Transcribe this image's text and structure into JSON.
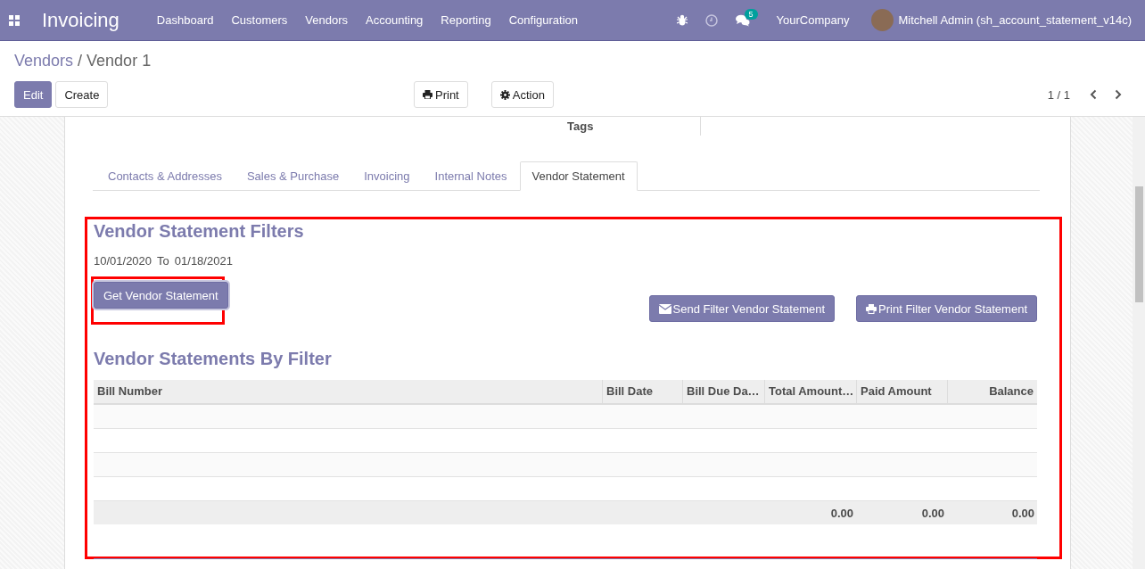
{
  "navbar": {
    "app_name": "Invoicing",
    "menu": [
      "Dashboard",
      "Customers",
      "Vendors",
      "Accounting",
      "Reporting",
      "Configuration"
    ],
    "messages_badge": "5",
    "company": "YourCompany",
    "user": "Mitchell Admin (sh_account_statement_v14c)"
  },
  "breadcrumb": {
    "parent": "Vendors",
    "separator": "/",
    "current": "Vendor 1"
  },
  "control_panel": {
    "edit": "Edit",
    "create": "Create",
    "print": "Print",
    "action": "Action",
    "pager": "1 / 1"
  },
  "form": {
    "tags_label": "Tags",
    "tabs": [
      {
        "label": "Contacts & Addresses",
        "selected": false
      },
      {
        "label": "Sales & Purchase",
        "selected": false
      },
      {
        "label": "Invoicing",
        "selected": false
      },
      {
        "label": "Internal Notes",
        "selected": false
      },
      {
        "label": "Vendor Statement",
        "selected": true
      }
    ],
    "filters": {
      "title": "Vendor Statement Filters",
      "date_from": "10/01/2020",
      "to_label": "To",
      "date_to": "01/18/2021",
      "get_button": "Get Vendor Statement",
      "send_button": "Send Filter Vendor Statement",
      "print_button": "Print Filter Vendor Statement"
    },
    "statements": {
      "title": "Vendor Statements By Filter",
      "columns": [
        {
          "label": "Bill Number"
        },
        {
          "label": "Bill Date"
        },
        {
          "label": "Bill Due Da…"
        },
        {
          "label": "Total Amount…",
          "total": "0.00"
        },
        {
          "label": "Paid Amount",
          "total": "0.00"
        },
        {
          "label": "Balance",
          "total": "0.00"
        }
      ]
    }
  }
}
